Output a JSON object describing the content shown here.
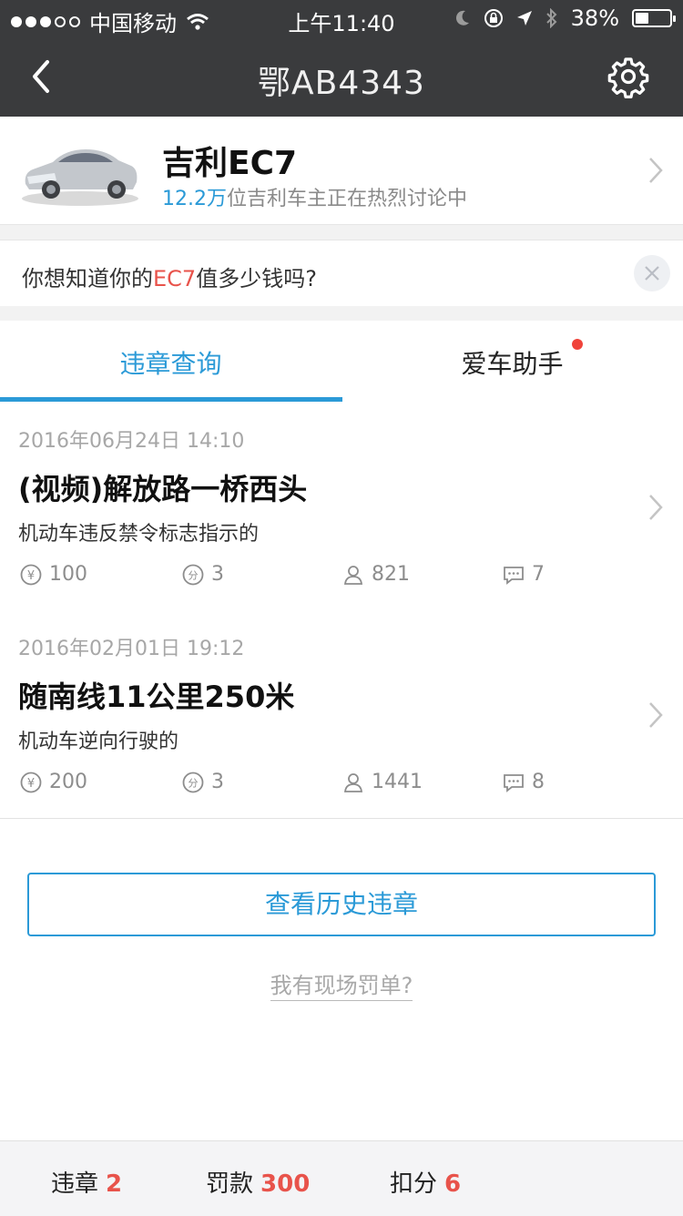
{
  "status": {
    "carrier": "中国移动",
    "time": "上午11:40",
    "battery": "38%",
    "battery_level": 0.38
  },
  "nav": {
    "title": "鄂AB4343"
  },
  "car": {
    "name": "吉利EC7",
    "discuss_count": "12.2万",
    "discuss_text": "位吉利车主正在热烈讨论中"
  },
  "banner": {
    "prefix": "你想知道你的",
    "highlight": "EC7",
    "suffix": "值多少钱吗?"
  },
  "tabs": [
    {
      "label": "违章查询",
      "active": true
    },
    {
      "label": "爱车助手",
      "has_badge": true
    }
  ],
  "records": [
    {
      "date": "2016年06月24日 14:10",
      "title": "(视频)解放路一桥西头",
      "desc": "机动车违反禁令标志指示的",
      "fine": "100",
      "points": "3",
      "viewers": "821",
      "comments": "7"
    },
    {
      "date": "2016年02月01日 19:12",
      "title": "随南线11公里250米",
      "desc": "机动车逆向行驶的",
      "fine": "200",
      "points": "3",
      "viewers": "1441",
      "comments": "8"
    }
  ],
  "actions": {
    "history_button": "查看历史违章",
    "ticket_link": "我有现场罚单?"
  },
  "footer": {
    "violations_label": "违章",
    "violations_value": "2",
    "fine_label": "罚款",
    "fine_value": "300",
    "points_label": "扣分",
    "points_value": "6"
  },
  "colors": {
    "accent": "#2b9ad7",
    "highlight_red": "#e8534b",
    "nav_bg": "#3a3b3d"
  }
}
